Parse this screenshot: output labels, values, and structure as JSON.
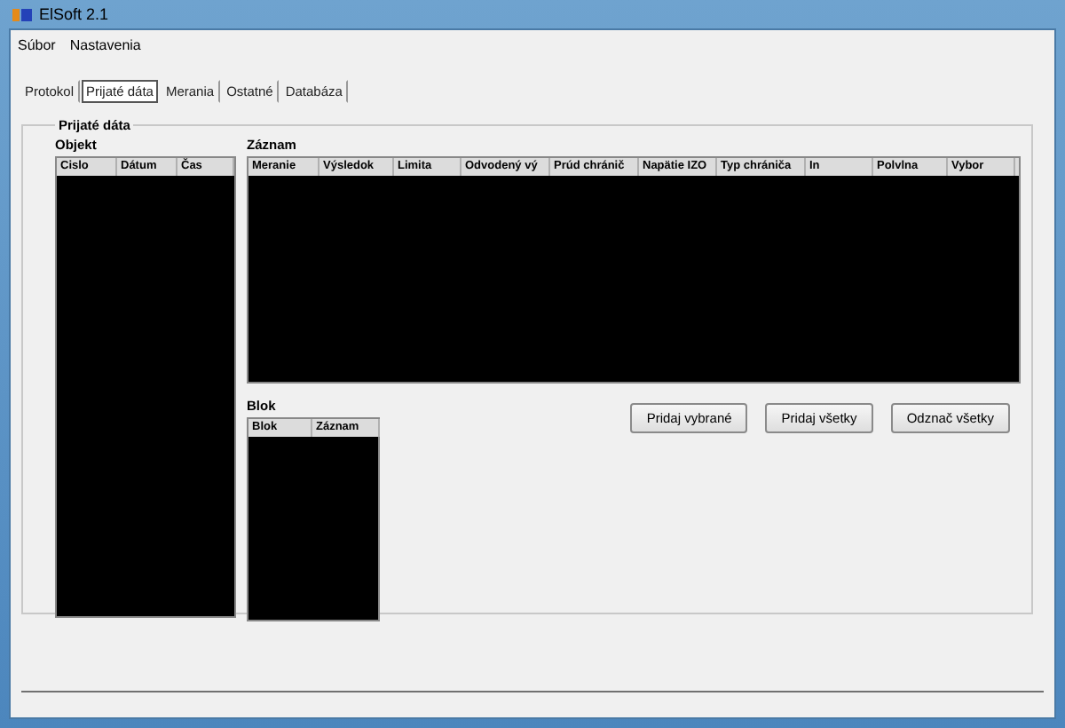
{
  "window": {
    "title": "ElSoft 2.1"
  },
  "menu": [
    "Súbor",
    "Nastavenia"
  ],
  "tabs": [
    {
      "label": "Protokol",
      "selected": false
    },
    {
      "label": "Prijaté dáta",
      "selected": true
    },
    {
      "label": "Merania",
      "selected": false
    },
    {
      "label": "Ostatné",
      "selected": false
    },
    {
      "label": "Databáza",
      "selected": false
    }
  ],
  "group": {
    "title": "Prijaté dáta"
  },
  "objekt": {
    "title": "Objekt",
    "columns": [
      "Cislo",
      "Dátum",
      "Čas"
    ]
  },
  "zaznam": {
    "title": "Záznam",
    "columns": [
      "Meranie",
      "Výsledok",
      "Limita",
      "Odvodený vý",
      "Prúd chránič",
      "Napätie IZO",
      "Typ chrániča",
      "In",
      "Polvlna",
      "Vybor"
    ]
  },
  "blok": {
    "title": "Blok",
    "columns": [
      "Blok",
      "Záznam"
    ]
  },
  "buttons": [
    "Pridaj vybrané",
    "Pridaj všetky",
    "Odznač všetky"
  ]
}
